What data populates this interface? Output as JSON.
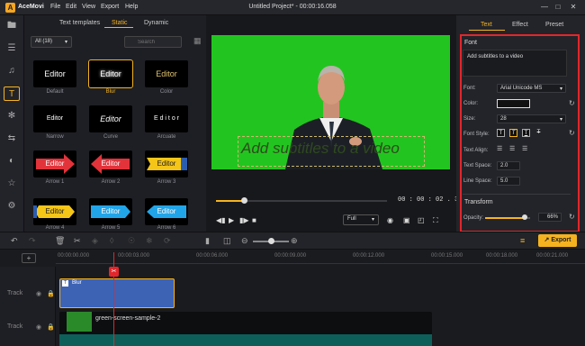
{
  "app": {
    "name": "AceMovi",
    "project_title": "Untitled Project* - 00:00:16.058",
    "menu": [
      "File",
      "Edit",
      "View",
      "Export",
      "Help"
    ],
    "window_controls": [
      "minimize-icon",
      "maximize-icon",
      "close-icon"
    ]
  },
  "rail": {
    "icons": [
      "folder-icon",
      "layers-icon",
      "audio-icon",
      "text-icon",
      "effects-icon",
      "transition-icon",
      "filter-icon",
      "sticker-icon",
      "settings-icon"
    ],
    "active_index": 3
  },
  "library": {
    "tabs": [
      "Text templates",
      "Static",
      "Dynamic"
    ],
    "active_tab": "Static",
    "filter_value": "All (18)",
    "search_placeholder": "Search",
    "items": [
      {
        "label": "Default",
        "text": "Editor",
        "style": "plain"
      },
      {
        "label": "Blur",
        "text": "Editor",
        "style": "blur"
      },
      {
        "label": "Color",
        "text": "Editor",
        "style": "color"
      },
      {
        "label": "Narrow",
        "text": "Editor",
        "style": "narrow"
      },
      {
        "label": "Curve",
        "text": "Editor",
        "style": "curve"
      },
      {
        "label": "Arcuate",
        "text": "E d i t o r",
        "style": "arcuate"
      },
      {
        "label": "Arrow 1",
        "text": "Editor",
        "style": "arrow-red-right"
      },
      {
        "label": "Arrow 2",
        "text": "Editor",
        "style": "arrow-red-left"
      },
      {
        "label": "Arrow 3",
        "text": "Editor",
        "style": "arrow-yellow"
      },
      {
        "label": "Arrow 4",
        "text": "Editor",
        "style": "arrow-yellow-blue"
      },
      {
        "label": "Arrow 5",
        "text": "Editor",
        "style": "arrow-blue"
      },
      {
        "label": "Arrow 6",
        "text": "Editor",
        "style": "arrow-blue-left"
      }
    ],
    "selected_index": 1
  },
  "preview": {
    "subtitle_text": "Add subtitles to a video",
    "timecode": "00 : 00 : 02 . 371",
    "quality": "Full",
    "progress_fraction": 0.17
  },
  "right_panel": {
    "tabs": [
      "Text",
      "Effect",
      "Preset"
    ],
    "active_tab": "Text",
    "font_heading": "Font",
    "text_value": "Add subtitles to a video",
    "font_label": "Font:",
    "font_value": "Arial Unicode MS",
    "color_label": "Color:",
    "size_label": "Size:",
    "size_value": "28",
    "font_style_label": "Font Style:",
    "font_style_buttons": [
      "T",
      "T",
      "T",
      "T"
    ],
    "text_align_label": "Text Align:",
    "text_space_label": "Text Space:",
    "text_space_value": "2.0",
    "line_space_label": "Line Space:",
    "line_space_value": "5.0",
    "transform_heading": "Transform",
    "opacity_label": "Opacity:",
    "opacity_value": "66%",
    "opacity_fraction": 0.66
  },
  "toolbar": {
    "export_label": "Export",
    "tools": [
      "undo-icon",
      "redo-icon",
      "delete-icon",
      "cut-icon",
      "split-icon",
      "crop-icon",
      "speed-icon",
      "freeze-icon",
      "marker-icon",
      "rotate-icon",
      "zoom-out-icon",
      "zoom-in-icon"
    ]
  },
  "timeline": {
    "ruler": [
      "00:00:00.000",
      "00:00:03.000",
      "00:00:06.000",
      "00:00:09.000",
      "00:00:12.000",
      "00:00:15.000",
      "00:00:18.000",
      "00:00:21.000"
    ],
    "tracks": [
      {
        "label": "Track",
        "clip": "Blur"
      },
      {
        "label": "Track",
        "clip": "green-screen-sample-2"
      }
    ]
  }
}
